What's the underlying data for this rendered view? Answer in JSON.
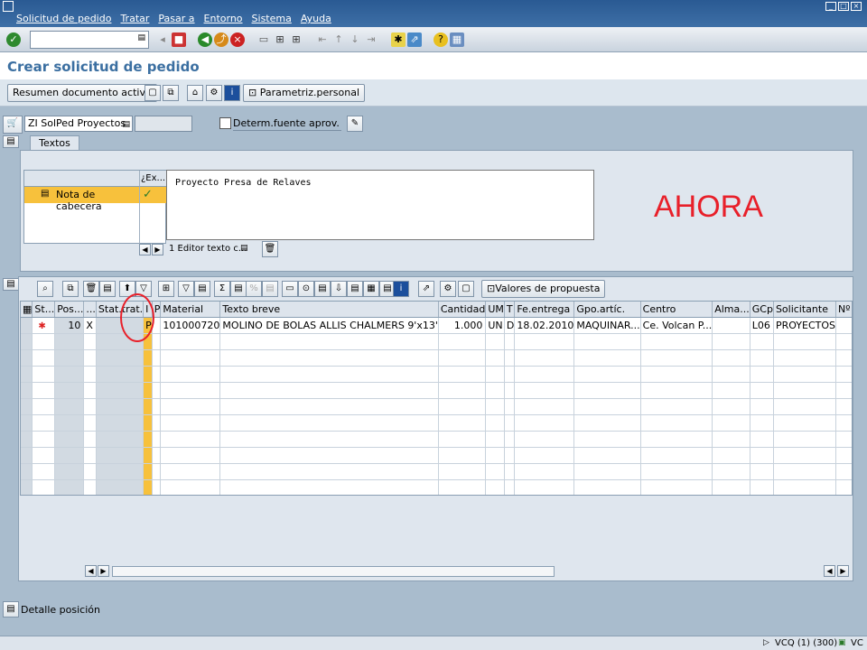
{
  "menubar": {
    "items": [
      "Solicitud de pedido",
      "Tratar",
      "Pasar a",
      "Entorno",
      "Sistema",
      "Ayuda"
    ]
  },
  "title": "Crear solicitud de pedido",
  "toolbar": {
    "summary_label": "Resumen documento activo",
    "personal_label": "Parametriz.personal"
  },
  "header": {
    "doc_type": "ZI SolPed Proyectos",
    "source_label": "Determ.fuente aprov."
  },
  "texts": {
    "tab_label": "Textos",
    "col_type": "",
    "col_exists": "¿Ex...",
    "note_label": "Nota de cabecera",
    "editor_content": "Proyecto Presa de Relaves",
    "editor_status": "1 Editor texto c..."
  },
  "annotation": "AHORA",
  "grid": {
    "toolbar_label": "Valores de propuesta",
    "columns": [
      "St...",
      "Pos...",
      "...",
      "Stat.trat.",
      "I",
      "P",
      "Material",
      "Texto breve",
      "Cantidad",
      "UM",
      "T",
      "Fe.entrega",
      "Gpo.artíc.",
      "Centro",
      "Alma...",
      "GCp",
      "Solicitante",
      "Nº n"
    ],
    "rows": [
      [
        "",
        "10",
        "X",
        "",
        "P",
        "",
        "101000720",
        "MOLINO DE BOLAS ALLIS CHALMERS 9'x13'",
        "1.000",
        "UN",
        "D",
        "18.02.2010",
        "MAQUINAR...",
        "Ce. Volcan P...",
        "",
        "L06",
        "PROYECTOS",
        ""
      ]
    ]
  },
  "footer": {
    "detail_label": "Detalle posición"
  },
  "status": {
    "system": "VCQ (1) (300)",
    "server": "VC"
  },
  "colors": {
    "title": "#3b6fa1",
    "highlight_column": "#f7c13c",
    "annotation": "#e8202a"
  }
}
